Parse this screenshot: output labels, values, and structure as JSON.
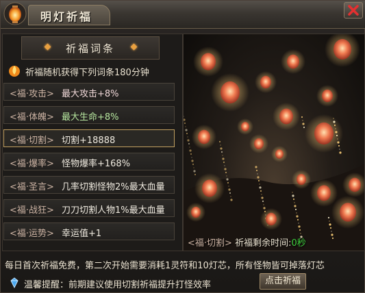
{
  "window": {
    "title": "明灯祈福"
  },
  "section": {
    "title": "祈福词条"
  },
  "info": "祈福随机获得下列词条180分钟",
  "blessings": [
    {
      "tag": "<福·攻击>",
      "effect": "最大攻击+8%",
      "color": "#f0d8d8",
      "selected": false
    },
    {
      "tag": "<福·体魄>",
      "effect": "最大生命+8%",
      "color": "#b8e8a0",
      "selected": false
    },
    {
      "tag": "<福·切割>",
      "effect": "切割+18888",
      "color": "#f0ebe0",
      "selected": true
    },
    {
      "tag": "<福·爆率>",
      "effect": "怪物爆率+168%",
      "color": "#f0ebe0",
      "selected": false
    },
    {
      "tag": "<福·圣言>",
      "effect": "几率切割怪物2%最大血量",
      "color": "#f0ebe0",
      "selected": false
    },
    {
      "tag": "<福·战狂>",
      "effect": "刀刀切割人物1%最大血量",
      "color": "#f0ebe0",
      "selected": false
    },
    {
      "tag": "<福·运势>",
      "effect": "幸运值+1",
      "color": "#f0ebe0",
      "selected": false
    }
  ],
  "status": {
    "tag": "<福·切割>",
    "label": "祈福剩余时间:",
    "time": "0秒"
  },
  "notice": "每日首次祈福免费，第二次开始需要消耗1灵符和10灯芯，所有怪物皆可掉落灯芯",
  "tip": "温馨提醒：前期建议使用切割祈福提升打怪效率",
  "button": {
    "label": "点击祈福"
  },
  "colors": {
    "accent_green": "#3ed03e",
    "tag_purple": "#cdb4a4",
    "gold_border": "#c2a060"
  }
}
